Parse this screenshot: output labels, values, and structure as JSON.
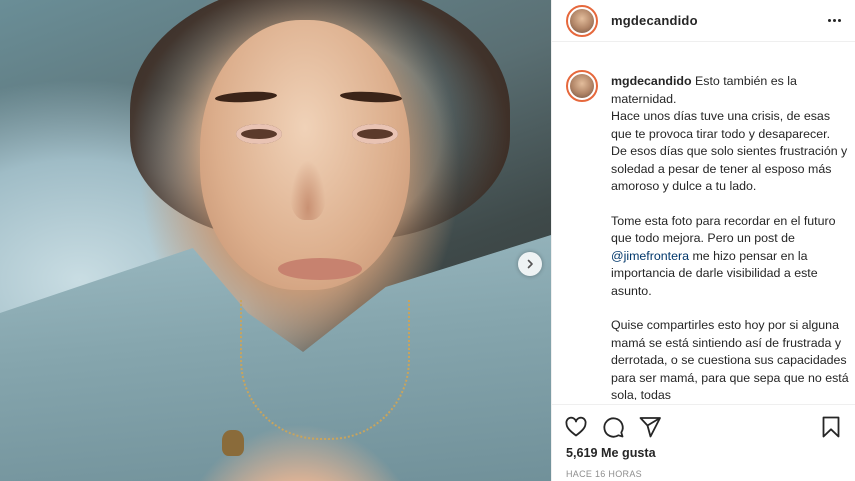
{
  "post": {
    "username": "mgdecandido",
    "more_icon": "more-horizontal-icon",
    "next_icon": "chevron-right-icon",
    "caption": {
      "username": "mgdecandido",
      "lead": " Esto también es la maternidad.",
      "line1": "Hace unos días tuve una crisis, de esas que te provoca tirar todo y desaparecer. De esos días que solo sientes frustración y soledad a pesar de tener al esposo más amoroso y dulce a tu lado.",
      "para2_before": "Tome esta foto para recordar en el futuro que todo mejora. Pero un post de ",
      "para2_mention": "@jimefrontera",
      "para2_after": " me hizo pensar en la importancia de darle visibilidad a este asunto.",
      "para3": "Quise compartirles esto hoy por si alguna mamá se está sintiendo así de frustrada y derrotada, o se cuestiona sus capacidades para ser mamá, para que sepa que no está sola, todas"
    },
    "actions": {
      "like_icon": "heart-icon",
      "comment_icon": "comment-icon",
      "share_icon": "share-icon",
      "save_icon": "bookmark-icon"
    },
    "likes": "5,619 Me gusta",
    "timestamp": "HACE 16 HORAS"
  }
}
